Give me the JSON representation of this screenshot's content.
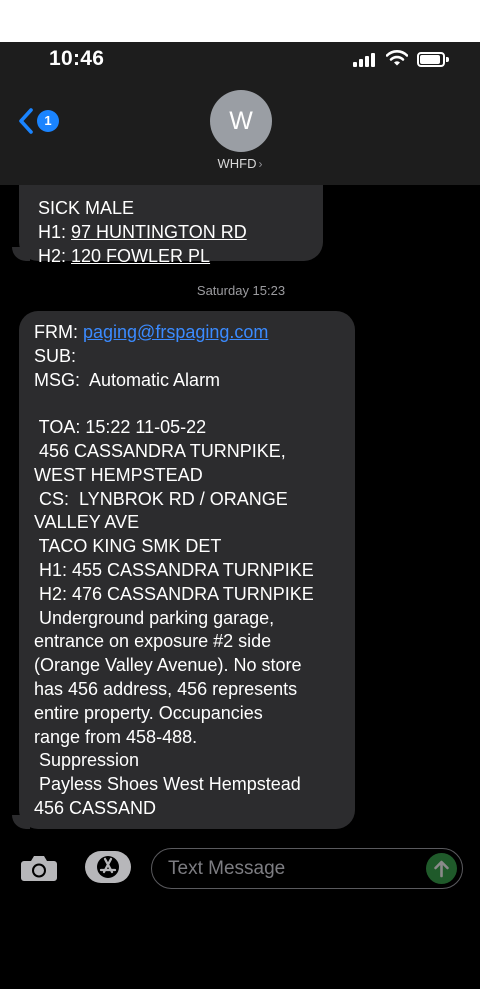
{
  "status_bar": {
    "time": "10:46"
  },
  "header": {
    "back_badge": "1",
    "avatar_initial": "W",
    "contact_name": "WHFD",
    "chevron": "›"
  },
  "thread": {
    "previous_message": {
      "lines": [
        {
          "prefix": "",
          "text": "SICK MALE"
        },
        {
          "prefix": "H1: ",
          "text": "97 HUNTINGTON RD"
        },
        {
          "prefix": "H2: ",
          "text": "120 FOWLER PL"
        }
      ]
    },
    "timestamp": "Saturday 15:23",
    "message": {
      "from_label": "FRM: ",
      "from_email": "paging@frspaging.com",
      "lines": [
        "SUB:",
        "MSG:  Automatic Alarm",
        "",
        " TOA: 15:22 11-05-22",
        " 456 CASSANDRA TURNPIKE,",
        "WEST HEMPSTEAD",
        " CS:  LYNBROK RD / ORANGE",
        "VALLEY AVE",
        " TACO KING SMK DET",
        " H1: 455 CASSANDRA TURNPIKE",
        " H2: 476 CASSANDRA TURNPIKE",
        " Underground parking garage,",
        "entrance on exposure #2 side",
        "(Orange Valley Avenue). No store",
        "has 456 address, 456 represents",
        "entire property. Occupancies",
        "range from 458-488.",
        " Suppression",
        " Payless Shoes West Hempstead",
        "456 CASSAND"
      ]
    }
  },
  "composer": {
    "placeholder": "Text Message",
    "camera_icon": "camera-icon",
    "apps_icon": "app-store-icon",
    "send_icon": "send-arrow-icon"
  },
  "colors": {
    "bubble": "#2c2c2e",
    "link": "#3b8bff",
    "badge": "#1a84ff",
    "header": "#1d1d1d"
  }
}
